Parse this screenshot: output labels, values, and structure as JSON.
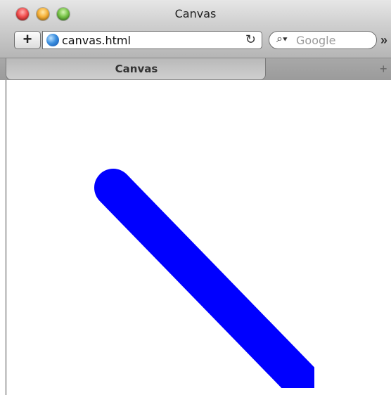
{
  "window": {
    "title": "Canvas"
  },
  "toolbar": {
    "add_label": "+",
    "address": "canvas.html",
    "search_placeholder": "Google",
    "icons": [
      "globe-icon",
      "reload-icon",
      "search-icon",
      "overflow-icon"
    ]
  },
  "tabs": [
    {
      "label": "Canvas",
      "active": true
    }
  ],
  "canvas": {
    "stroke_color": "#0000ff",
    "line_cap": "round"
  }
}
